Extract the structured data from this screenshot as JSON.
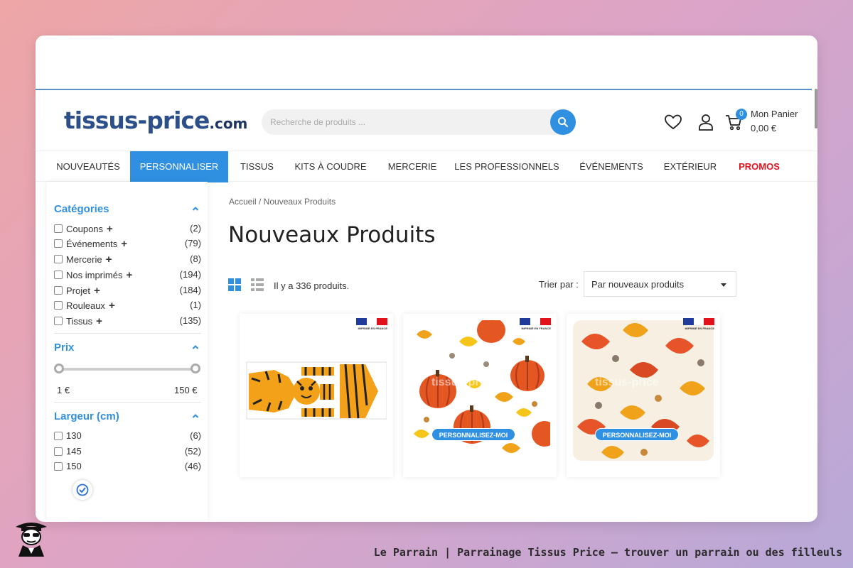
{
  "header": {
    "logo_main": "tissus-price",
    "logo_suffix": ".com",
    "search_placeholder": "Recherche de produits ...",
    "cart_count": "0",
    "cart_label": "Mon Panier",
    "cart_total": "0,00 €"
  },
  "nav": {
    "items": [
      {
        "label": "NOUVEAUTÉS"
      },
      {
        "label": "PERSONNALISER"
      },
      {
        "label": "TISSUS"
      },
      {
        "label": "KITS À COUDRE"
      },
      {
        "label": "MERCERIE"
      },
      {
        "label": "LES PROFESSIONNELS"
      },
      {
        "label": "ÉVÉNEMENTS"
      },
      {
        "label": "EXTÉRIEUR"
      },
      {
        "label": "PROMOS"
      }
    ],
    "active_index": 1,
    "promo_color": "#e0141e"
  },
  "sidebar": {
    "categories_title": "Catégories",
    "categories": [
      {
        "label": "Coupons",
        "plus": "+",
        "count": "(2)"
      },
      {
        "label": "Événements",
        "plus": "+",
        "count": "(79)"
      },
      {
        "label": "Mercerie",
        "plus": "+",
        "count": "(8)"
      },
      {
        "label": "Nos imprimés",
        "plus": "+",
        "count": "(194)"
      },
      {
        "label": "Projet",
        "plus": "+",
        "count": "(184)"
      },
      {
        "label": "Rouleaux",
        "plus": "+",
        "count": "(1)"
      },
      {
        "label": "Tissus",
        "plus": "+",
        "count": "(135)"
      }
    ],
    "price_title": "Prix",
    "price_min": "1 €",
    "price_max": "150 €",
    "width_title": "Largeur (cm)",
    "widths": [
      {
        "label": "130",
        "count": "(6)"
      },
      {
        "label": "145",
        "count": "(52)"
      },
      {
        "label": "150",
        "count": "(46)"
      }
    ]
  },
  "main": {
    "breadcrumb": "Accueil / Nouveaux Produits",
    "title": "Nouveaux Produits",
    "count_text": "Il y a 336 produits.",
    "sort_label": "Trier par :",
    "sort_value": "Par nouveaux produits",
    "products": [
      {
        "pattern": "tiger",
        "flag_text": "IMPRIMÉ EN FRANCE"
      },
      {
        "pattern": "pumpkins",
        "flag_text": "IMPRIMÉ EN FRANCE",
        "button": "PERSONNALISEZ-MOI",
        "watermark": "tissus-price"
      },
      {
        "pattern": "autumn-leaves",
        "flag_text": "IMPRIMÉ EN FRANCE",
        "button": "PERSONNALISEZ-MOI",
        "watermark": "tissus-price"
      }
    ]
  },
  "colors": {
    "accent": "#2f8fe0",
    "logo": "#2c4f8a"
  },
  "footer": {
    "caption": "Le Parrain | Parrainage Tissus Price — trouver un parrain ou des filleuls"
  }
}
